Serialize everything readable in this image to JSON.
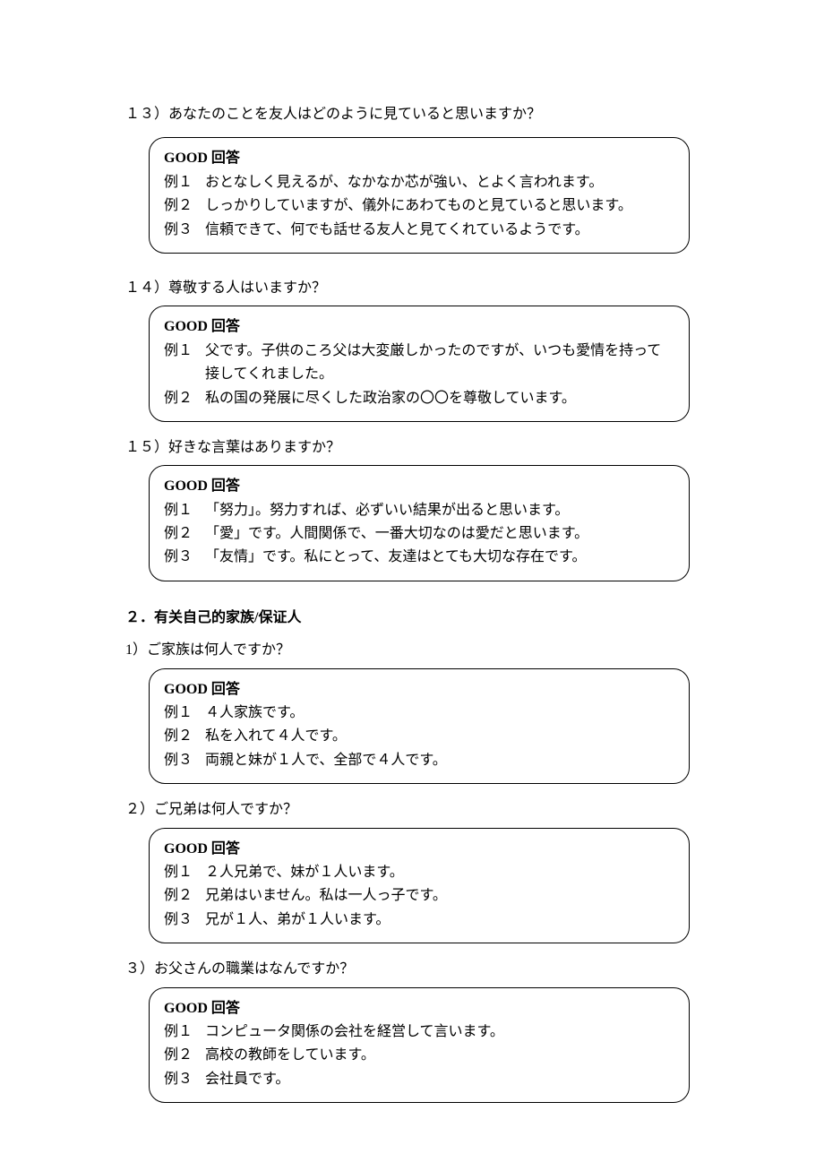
{
  "q13": {
    "question": "１３）あなたのことを友人はどのように見ていると思いますか？",
    "header": "GOOD 回答",
    "examples": [
      {
        "label": "例１",
        "text": "おとなしく見えるが、なかなか芯が強い、とよく言われます。"
      },
      {
        "label": "例２",
        "text": "しっかりしていますが、儀外にあわてものと見ていると思います。"
      },
      {
        "label": "例３",
        "text": "信頼できて、何でも話せる友人と見てくれているようです。"
      }
    ]
  },
  "q14": {
    "question": "１４）尊敬する人はいますか？",
    "header": "GOOD 回答",
    "examples": [
      {
        "label": "例１",
        "text": "父です。子供のころ父は大変厳しかったのですが、いつも愛情を持って接してくれました。"
      },
      {
        "label": "例２",
        "text": "私の国の発展に尽くした政治家の〇〇を尊敬しています。"
      }
    ]
  },
  "q15": {
    "question": "１５）好きな言葉はありますか？",
    "header": "GOOD 回答",
    "examples": [
      {
        "label": "例１",
        "text": "「努力」。努力すれば、必ずいい結果が出ると思います。"
      },
      {
        "label": "例２",
        "text": "「愛」です。人間関係で、一番大切なのは愛だと思います。"
      },
      {
        "label": "例３",
        "text": "「友情」です。私にとって、友達はとても大切な存在です。"
      }
    ]
  },
  "section2": {
    "title": "２．有关自己的家族/保证人"
  },
  "s2q1": {
    "question": "1）ご家族は何人ですか？",
    "header": "GOOD 回答",
    "examples": [
      {
        "label": "例１",
        "text": "４人家族です。"
      },
      {
        "label": "例２",
        "text": "私を入れて４人です。"
      },
      {
        "label": "例３",
        "text": "両親と妹が１人で、全部で４人です。"
      }
    ]
  },
  "s2q2": {
    "question": "２）ご兄弟は何人ですか？",
    "header": "GOOD 回答",
    "examples": [
      {
        "label": "例１",
        "text": "２人兄弟で、妹が１人います。"
      },
      {
        "label": "例２",
        "text": "兄弟はいません。私は一人っ子です。"
      },
      {
        "label": "例３",
        "text": "兄が１人、弟が１人います。"
      }
    ]
  },
  "s2q3": {
    "question": "３）お父さんの職業はなんですか？",
    "header": "GOOD 回答",
    "examples": [
      {
        "label": "例１",
        "text": "コンピュータ関係の会社を経営して言います。"
      },
      {
        "label": "例２",
        "text": "高校の教師をしています。"
      },
      {
        "label": "例３",
        "text": "会社員です。"
      }
    ]
  }
}
